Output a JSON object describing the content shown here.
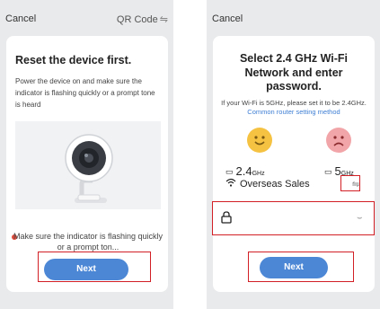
{
  "left_screen": {
    "cancel_label": "Cancel",
    "qr_label": "QR Code",
    "qr_icon": "swap-icon",
    "title": "Reset the device first.",
    "description": "Power the device on and make sure the indicator is flashing quickly or a prompt tone is heard",
    "illustration": "camera-icon",
    "hint": "Make sure the indicator is flashing quickly or a prompt ton...",
    "next_label": "Next"
  },
  "right_screen": {
    "cancel_label": "Cancel",
    "title": "Select 2.4 GHz Wi-Fi Network and enter password.",
    "description": "If your Wi-Fi is 5GHz, please set it to be 2.4GHz.",
    "link_text": "Common router setting method",
    "band_24": "2.4",
    "band_24_unit": "GHz",
    "band_5": "5",
    "band_5_unit": "GHz",
    "wifi_name": "Overseas Sales",
    "password_value": "",
    "next_label": "Next"
  },
  "colors": {
    "accent": "#4c87d6",
    "highlight": "#d21f26",
    "happy": "#f5c242",
    "sad": "#f2a5a8",
    "hint_dot": "#e24a3b"
  }
}
